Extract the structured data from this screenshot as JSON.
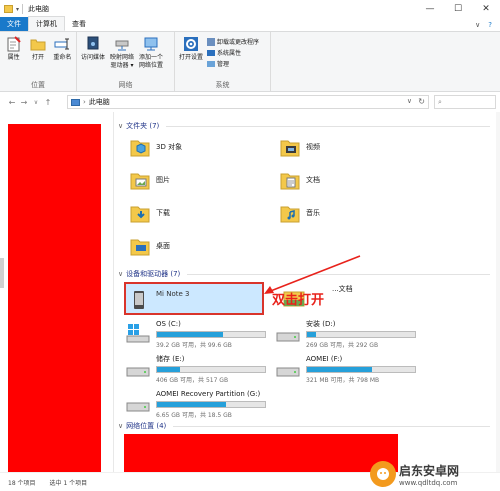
{
  "window": {
    "title": "此电脑",
    "controls": {
      "minimize": "—",
      "maximize": "☐",
      "close": "✕"
    }
  },
  "ribbon_tabs": [
    {
      "label": "文件"
    },
    {
      "label": "计算机"
    },
    {
      "label": "查看"
    }
  ],
  "ribbon": {
    "location": {
      "label": "位置",
      "buttons": [
        {
          "label": "属性"
        },
        {
          "label": "打开"
        },
        {
          "label": "重命名"
        }
      ]
    },
    "network": {
      "label": "网络",
      "buttons": [
        {
          "label": "访问媒体"
        },
        {
          "label": "映射网络驱动器 ▾"
        },
        {
          "label": "添加一个网络位置"
        }
      ]
    },
    "system": {
      "label": "系统",
      "buttons": [
        {
          "label": "打开设置"
        }
      ],
      "list": [
        {
          "label": "卸载或更改程序"
        },
        {
          "label": "系统属性"
        },
        {
          "label": "管理"
        }
      ]
    }
  },
  "address_bar": {
    "nav": {
      "back": "←",
      "forward": "→",
      "recent": "∨",
      "up": "↑"
    },
    "path": "此电脑",
    "refresh": "↻",
    "dropdown": "∨"
  },
  "search": {
    "icon": "⌕",
    "placeholder": ""
  },
  "sections": {
    "folders": {
      "title": "文件夹 (7)"
    },
    "devices": {
      "title": "设备和驱动器 (7)"
    },
    "network": {
      "title": "网络位置 (4)"
    }
  },
  "folders": [
    {
      "name": "3D 对象",
      "icon": "3d-objects-folder-icon"
    },
    {
      "name": "视频",
      "icon": "videos-folder-icon"
    },
    {
      "name": "图片",
      "icon": "pictures-folder-icon"
    },
    {
      "name": "文档",
      "icon": "documents-folder-icon"
    },
    {
      "name": "下载",
      "icon": "downloads-folder-icon"
    },
    {
      "name": "音乐",
      "icon": "music-folder-icon"
    },
    {
      "name": "桌面",
      "icon": "desktop-folder-icon"
    }
  ],
  "devices": [
    {
      "name": "Mi Note 3",
      "selected": true
    },
    {
      "name": "...文档"
    },
    {
      "name": "OS (C:)",
      "size": "39.2 GB 可用，共 99.6 GB",
      "used_fraction": 0.61
    },
    {
      "name": "安装 (D:)",
      "size": "269 GB 可用，共 292 GB",
      "used_fraction": 0.08
    },
    {
      "name": "储存 (E:)",
      "size": "406 GB 可用，共 517 GB",
      "used_fraction": 0.21
    },
    {
      "name": "AOMEI (F:)",
      "size": "321 MB 可用，共 798 MB",
      "used_fraction": 0.6
    },
    {
      "name": "AOMEI Recovery Partition (G:)",
      "size": "6.65 GB 可用，共 18.5 GB",
      "used_fraction": 0.64
    }
  ],
  "annotation": {
    "text": "双击打开",
    "color": "#e8221b"
  },
  "status": {
    "count": "18 个项目",
    "selected": "选中 1 个项目"
  },
  "watermark": {
    "name": "启东安卓网",
    "url": "www.qdltdq.com"
  },
  "colors": {
    "accent": "#1979ca",
    "selection": "#cce8ff",
    "bar": "#26a0da",
    "redact": "#ff0000"
  }
}
